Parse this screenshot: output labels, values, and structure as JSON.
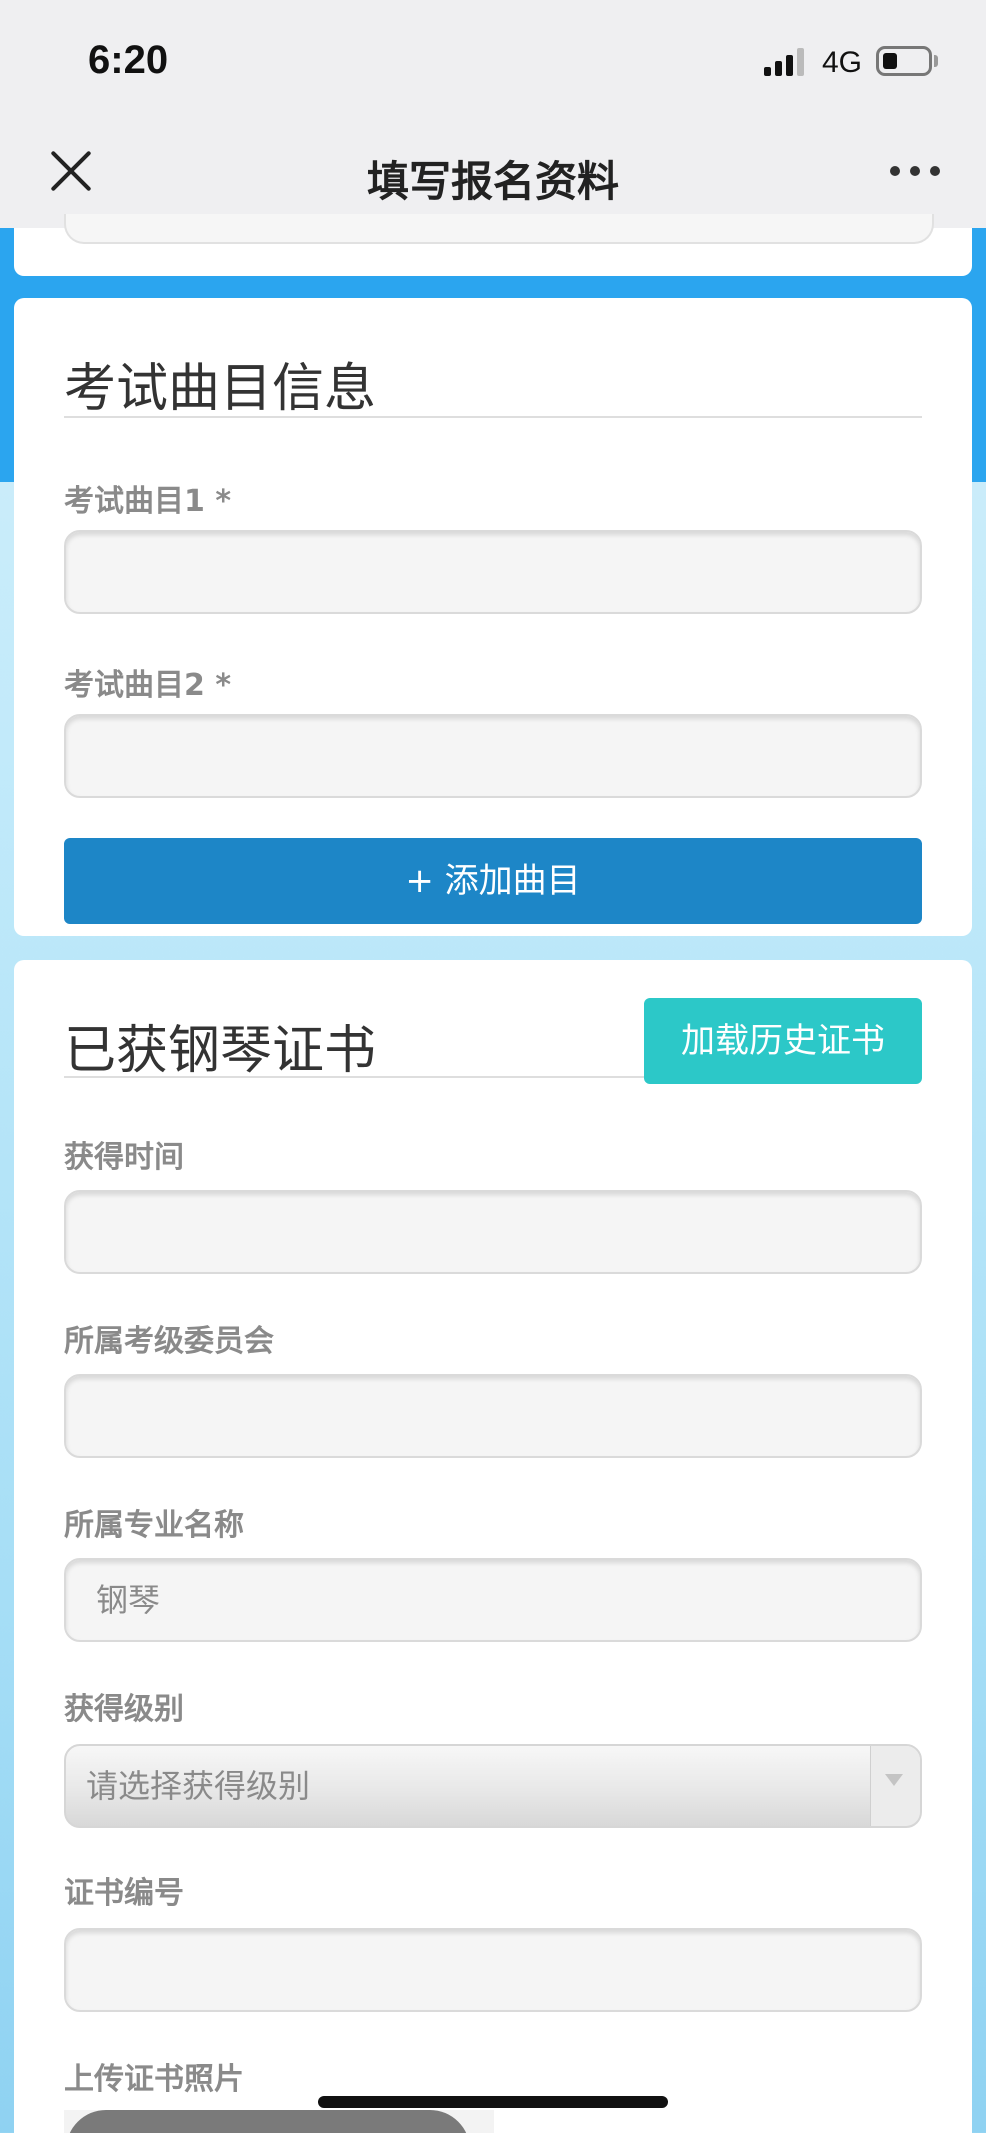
{
  "status_bar": {
    "time": "6:20",
    "network": "4G"
  },
  "nav": {
    "title": "填写报名资料"
  },
  "pieces_section": {
    "title": "考试曲目信息",
    "fields": [
      {
        "label": "考试曲目1 *",
        "value": ""
      },
      {
        "label": "考试曲目2 *",
        "value": ""
      }
    ],
    "add_button": "+ 添加曲目"
  },
  "certificate_section": {
    "title": "已获钢琴证书",
    "load_button": "加载历史证书",
    "obtain_time": {
      "label": "获得时间",
      "value": ""
    },
    "committee": {
      "label": "所属考级委员会",
      "value": ""
    },
    "major": {
      "label": "所属专业名称",
      "value": "钢琴"
    },
    "level": {
      "label": "获得级别",
      "placeholder": "请选择获得级别"
    },
    "cert_number": {
      "label": "证书编号",
      "value": ""
    },
    "upload": {
      "label": "上传证书照片"
    }
  }
}
